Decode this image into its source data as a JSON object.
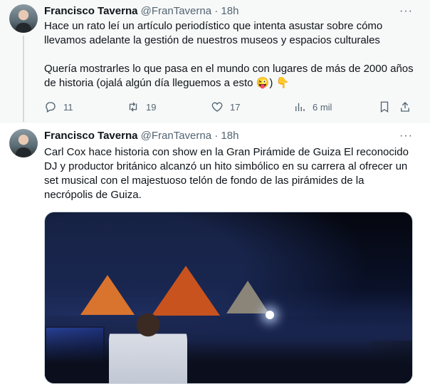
{
  "tweets": [
    {
      "name": "Francisco Taverna",
      "handle": "@FranTaverna",
      "dot": "·",
      "time": "18h",
      "more": "···",
      "paragraphs": [
        "Hace un rato leí un artículo periodístico que intenta asustar sobre cómo llevamos adelante la gestión de nuestros museos y espacios culturales",
        "Quería mostrarles lo que pasa en el mundo con lugares de más de 2000 años de historia (ojalá algún día lleguemos a esto 😜) 👇"
      ],
      "actions": {
        "replies": "11",
        "retweets": "19",
        "likes": "17",
        "views": "6 mil"
      }
    },
    {
      "name": "Francisco Taverna",
      "handle": "@FranTaverna",
      "dot": "·",
      "time": "18h",
      "more": "···",
      "text": "Carl Cox hace historia con show en la Gran Pirámide de Guiza El reconocido DJ y productor británico alcanzó un hito simbólico en su carrera al ofrecer un set musical con el majestuoso telón de fondo de las pirámides de la necrópolis de Guiza."
    }
  ],
  "colors": {
    "secondary_text": "#536471",
    "thread_line": "#cfd9de",
    "highlight_bg": "#f7f9f9"
  }
}
